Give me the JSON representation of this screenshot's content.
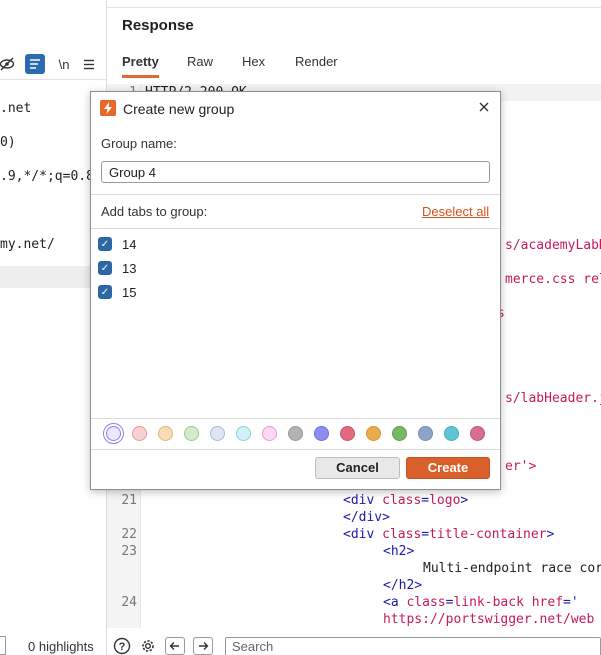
{
  "request_pane": {
    "toolbar": {
      "hide_icon": "eye-slash-icon",
      "format_icon": "wrap-icon",
      "newline_label": "\\n",
      "menu_icon": "hamburger-icon"
    },
    "lines": [
      ".net",
      "0)",
      ".9,*/*;q=0.8",
      "my.net/"
    ],
    "footer": {
      "highlights": "0 highlights"
    }
  },
  "response_pane": {
    "title": "Response",
    "tabs": [
      {
        "label": "Pretty",
        "active": true
      },
      {
        "label": "Raw"
      },
      {
        "label": "Hex"
      },
      {
        "label": "Render"
      }
    ],
    "first_line": "HTTP/2 200 OK",
    "code_fragments": {
      "academy": "s/academyLabH",
      "commerce_a": "merce.css",
      "commerce_b": "rel=",
      "s_frag": "s",
      "lab_header": "s/labHeader.j",
      "er_frag": "er'>",
      "lines": [
        {
          "num": "21",
          "parts": [
            [
              "tag",
              "<div "
            ],
            [
              "attr",
              "class"
            ],
            [
              "tag",
              "="
            ],
            [
              "val",
              "logo"
            ],
            [
              "tag",
              ">"
            ]
          ]
        },
        {
          "num": "",
          "parts": [
            [
              "tag",
              "</div>"
            ]
          ]
        },
        {
          "num": "22",
          "parts": [
            [
              "tag",
              "<div "
            ],
            [
              "attr",
              "class"
            ],
            [
              "tag",
              "="
            ],
            [
              "val",
              "title-container"
            ],
            [
              "tag",
              ">"
            ]
          ]
        },
        {
          "num": "23",
          "parts": [
            [
              "tag",
              "<h2>"
            ]
          ]
        },
        {
          "num": "",
          "parts": [
            [
              "txt",
              "Multi-endpoint race cor"
            ]
          ]
        },
        {
          "num": "",
          "parts": [
            [
              "tag",
              "</h2>"
            ]
          ]
        },
        {
          "num": "24",
          "parts": [
            [
              "tag",
              "<a "
            ],
            [
              "attr",
              "class"
            ],
            [
              "tag",
              "="
            ],
            [
              "val",
              "link-back"
            ],
            [
              "tag",
              " "
            ],
            [
              "attr",
              "href"
            ],
            [
              "tag",
              "='"
            ]
          ]
        },
        {
          "num": "",
          "parts": [
            [
              "val",
              "https://portswigger.net/web"
            ]
          ]
        }
      ]
    },
    "bottom_bar": {
      "help_icon": "help-icon",
      "settings_icon": "gear-icon",
      "back_icon": "arrow-left-icon",
      "forward_icon": "arrow-right-icon",
      "search_placeholder": "Search"
    }
  },
  "dialog": {
    "title": "Create new group",
    "close_icon": "close-icon",
    "group_name_label": "Group name:",
    "group_name_value": "Group 4",
    "add_tabs_label": "Add tabs to group:",
    "deselect_all": "Deselect all",
    "tabs": [
      {
        "label": "14",
        "checked": true
      },
      {
        "label": "13",
        "checked": true
      },
      {
        "label": "15",
        "checked": true
      }
    ],
    "colors": [
      {
        "fill": "#ede9fb",
        "border": "#8a7cf4",
        "selected": true
      },
      {
        "fill": "#f8d2d2",
        "border": "#e49a9a"
      },
      {
        "fill": "#f8dcb6",
        "border": "#e2b47a"
      },
      {
        "fill": "#d4ecc9",
        "border": "#98cc84"
      },
      {
        "fill": "#dde6f3",
        "border": "#a8bbd6"
      },
      {
        "fill": "#d3f1f6",
        "border": "#86d2de"
      },
      {
        "fill": "#fbd9f2",
        "border": "#e59ad4"
      },
      {
        "fill": "#b3b3b3",
        "border": "#999999"
      },
      {
        "fill": "#8f8df2",
        "border": "#6f6ce2"
      },
      {
        "fill": "#e06b7f",
        "border": "#c9566a"
      },
      {
        "fill": "#e8ad4a",
        "border": "#d39535"
      },
      {
        "fill": "#78b865",
        "border": "#5f9f4d"
      },
      {
        "fill": "#8ea4c7",
        "border": "#768db2"
      },
      {
        "fill": "#5fc4d3",
        "border": "#47adbd"
      },
      {
        "fill": "#d86c94",
        "border": "#c1557e"
      }
    ],
    "cancel_label": "Cancel",
    "create_label": "Create"
  }
}
